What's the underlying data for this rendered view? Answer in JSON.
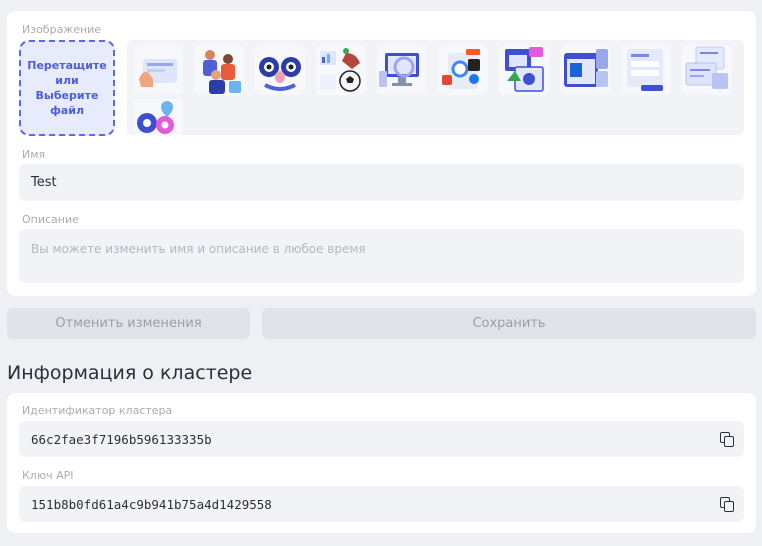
{
  "form": {
    "image_label": "Изображение",
    "dropzone": {
      "line1": "Перетащите",
      "line2": "или",
      "line3": "Выберите файл"
    },
    "gallery_icons": [
      "hand-screen-illustration-icon",
      "team-people-illustration-icon",
      "glasses-mask-illustration-icon",
      "charts-ball-illustration-icon",
      "monitor-refresh-illustration-icon",
      "apps-logos-illustration-icon",
      "xd-windows-illustration-icon",
      "cloud-window-illustration-icon",
      "form-card-illustration-icon",
      "documents-illustration-icon",
      "location-pins-illustration-icon"
    ],
    "name_label": "Имя",
    "name_value": "Test",
    "description_label": "Описание",
    "description_placeholder": "Вы можете изменить имя и описание в любое время"
  },
  "actions": {
    "cancel_label": "Отменить изменения",
    "save_label": "Сохранить"
  },
  "cluster_info": {
    "title": "Информация о кластере",
    "cluster_id_label": "Идентификатор кластера",
    "cluster_id_value": "66c2fae3f7196b596133335b",
    "api_key_label": "Ключ API",
    "api_key_value": "151b8b0fd61a4c9b941b75a4d1429558"
  },
  "colors": {
    "accent": "#4d5fd6",
    "dropzone_bg": "#e7ebfb",
    "field_bg": "#f2f3f6",
    "button_bg": "#e1e3e9"
  }
}
